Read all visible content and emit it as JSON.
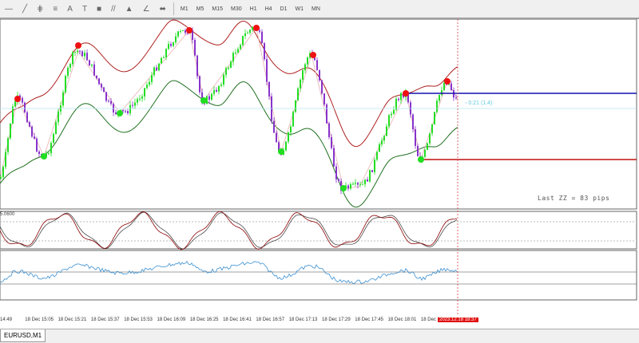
{
  "toolbar": {
    "tools": [
      "—",
      "╱",
      "⋕",
      "≡",
      "A",
      "T",
      "■",
      "//",
      "▲",
      "∠",
      "⬌"
    ],
    "timeframes": [
      "M1",
      "M5",
      "M15",
      "M30",
      "H1",
      "H4",
      "D1",
      "W1",
      "MN"
    ]
  },
  "chart": {
    "symbol_tab": "EURUSD,M1",
    "last_zz": "Last ZZ = 83 pips",
    "countdown": "◦ 0:21 (1.4)",
    "oscillator_label": "5.0600",
    "time_labels": [
      "14:49",
      "18 Dec 15:05",
      "18 Dec 15:21",
      "18 Dec 15:37",
      "18 Dec 15:53",
      "18 Dec 16:09",
      "18 Dec 16:25",
      "18 Dec 16:41",
      "18 Dec 16:57",
      "18 Dec 17:13",
      "18 Dec 17:29",
      "18 Dec 17:45",
      "18 Dec 18:01",
      "18 Dec 18"
    ],
    "current_time": "2023.12.18 18:37",
    "colors": {
      "bull": "#22dd22",
      "bear": "#8833cc",
      "upper_band": "#b02020",
      "lower_band": "#207020",
      "zz_high": "#ee1111",
      "zz_low": "#22dd22",
      "resistance": "#1010b0",
      "support": "#c01010",
      "stoch_main": "#8b0000",
      "stoch_signal": "#333",
      "rsi": "#3a8fd0"
    }
  }
}
